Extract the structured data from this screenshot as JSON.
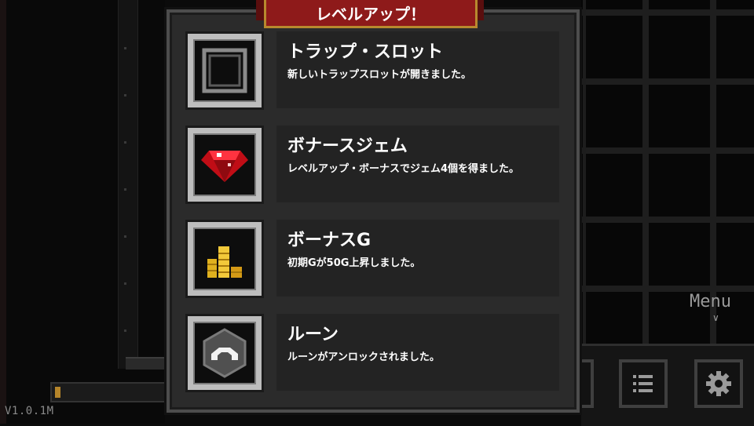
{
  "dialog": {
    "title": "レベルアップ！",
    "rewards": [
      {
        "icon": "trap-slot-icon",
        "title": "トラップ・スロット",
        "description": "新しいトラップスロットが開きました。"
      },
      {
        "icon": "ruby-gem-icon",
        "title": "ボナースジェム",
        "description": "レベルアップ・ボーナスでジェム4個を得ました。"
      },
      {
        "icon": "gold-coins-icon",
        "title": "ボーナスG",
        "description": "初期Gが50G上昇しました。"
      },
      {
        "icon": "rune-icon",
        "title": "ルーン",
        "description": "ルーンがアンロックされました。"
      }
    ]
  },
  "hud": {
    "menu_label": "Menu",
    "version": "V1.0.1M",
    "progress": 0.05
  },
  "colors": {
    "banner": "#8e1a1a",
    "banner_border": "#b8892e",
    "panel": "#2b2b2b",
    "gold": "#e0b11e",
    "ruby": "#d8121c"
  }
}
